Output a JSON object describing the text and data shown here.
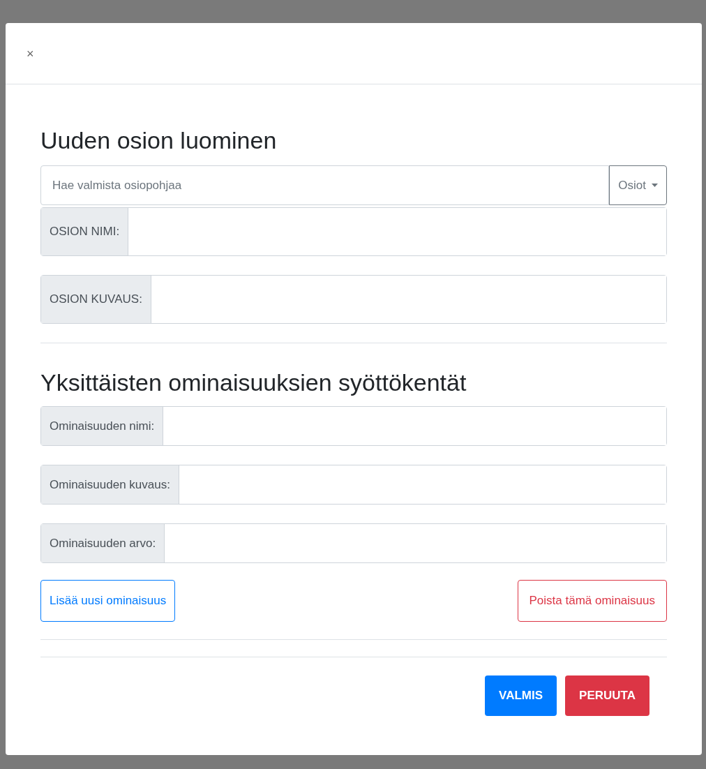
{
  "modal": {
    "close": "×"
  },
  "section": {
    "title": "Uuden osion luominen",
    "search": {
      "placeholder": "Hae valmista osiopohjaa"
    },
    "dropdown": "Osiot",
    "fields": [
      {
        "label": "OSION NIMI:"
      },
      {
        "label": "OSION KUVAUS:"
      }
    ]
  },
  "properties": {
    "title": "Yksittäisten ominaisuuksien syöttökentät",
    "fields": [
      {
        "label": "Ominaisuuden nimi:"
      },
      {
        "label": "Ominaisuuden kuvaus:"
      },
      {
        "label": "Ominaisuuden arvo:"
      }
    ],
    "add_button": "Lisää uusi ominaisuus",
    "remove_button": "Poista tämä ominaisuus"
  },
  "footer": {
    "buttons": [
      {
        "label": "VALMIS",
        "kind": "primary"
      },
      {
        "label": "PERUUTA",
        "kind": "danger"
      }
    ]
  }
}
